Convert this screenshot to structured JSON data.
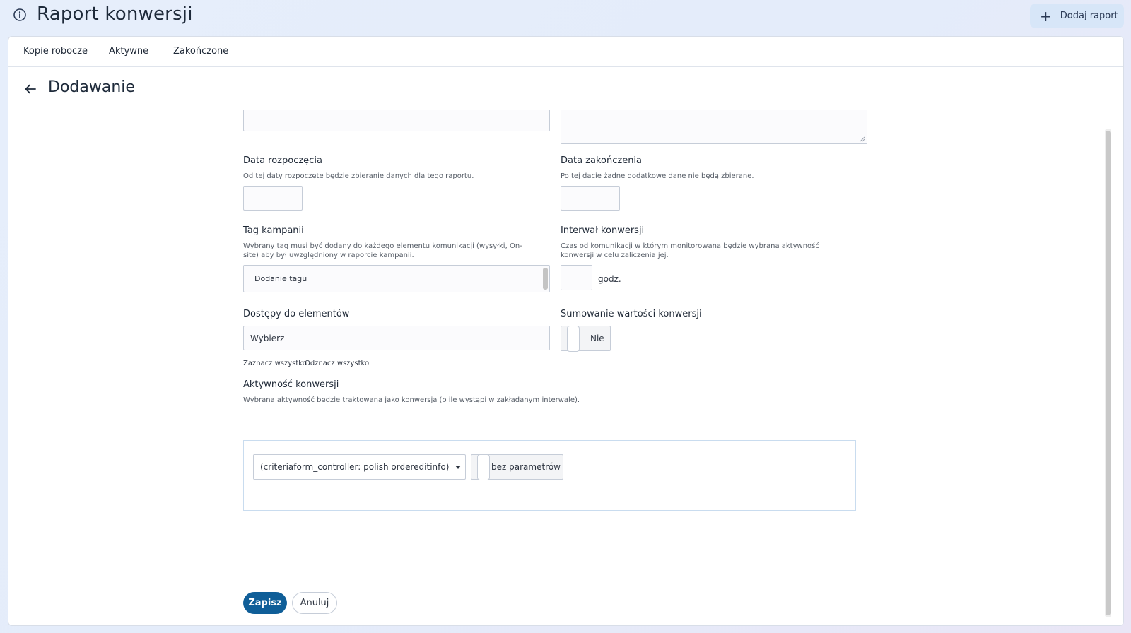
{
  "header": {
    "title": "Raport konwersji",
    "add_button_label": "Dodaj raport",
    "info_icon": "info-circle-icon",
    "add_icon": "plus-icon"
  },
  "tabs": [
    {
      "label": "Kopie robocze"
    },
    {
      "label": "Aktywne"
    },
    {
      "label": "Zakończone"
    }
  ],
  "page": {
    "heading": "Dodawanie",
    "back_icon": "arrow-left-icon"
  },
  "form": {
    "start_date": {
      "label": "Data rozpoczęcia",
      "help": "Od tej daty rozpoczęte będzie zbieranie danych dla tego raportu.",
      "value": ""
    },
    "end_date": {
      "label": "Data zakończenia",
      "help": "Po tej dacie żadne dodatkowe dane nie będą zbierane.",
      "value": ""
    },
    "campaign_tag": {
      "label": "Tag kampanii",
      "help": "Wybrany tag musi być dodany do każdego elementu komunikacji (wysyłki, On-site) aby był uwzględniony w raporcie kampanii.",
      "placeholder": "Dodanie tagu"
    },
    "conversion_interval": {
      "label": "Interwał konwersji",
      "help": "Czas od komunikacji w którym monitorowana będzie wybrana aktywność konwersji w celu zaliczenia jej.",
      "value": "",
      "unit": "godz."
    },
    "element_access": {
      "label": "Dostępy do elementów",
      "placeholder": "Wybierz",
      "select_all": "Zaznacz wszystko",
      "deselect_all": "Odznacz wszystko"
    },
    "sum_conversion_values": {
      "label": "Sumowanie wartości konwersji",
      "toggle_text": "Nie",
      "enabled": false
    },
    "conversion_activity": {
      "label": "Aktywność konwersji",
      "help": "Wybrana aktywność będzie traktowana jako konwersja (o ile wystąpi w zakładanym interwale).",
      "selected": "(criteriaform_controller: polish ordereditinfo)",
      "params_toggle_text": "bez parametrów",
      "params_enabled": false
    }
  },
  "actions": {
    "save": "Zapisz",
    "cancel": "Anuluj"
  }
}
